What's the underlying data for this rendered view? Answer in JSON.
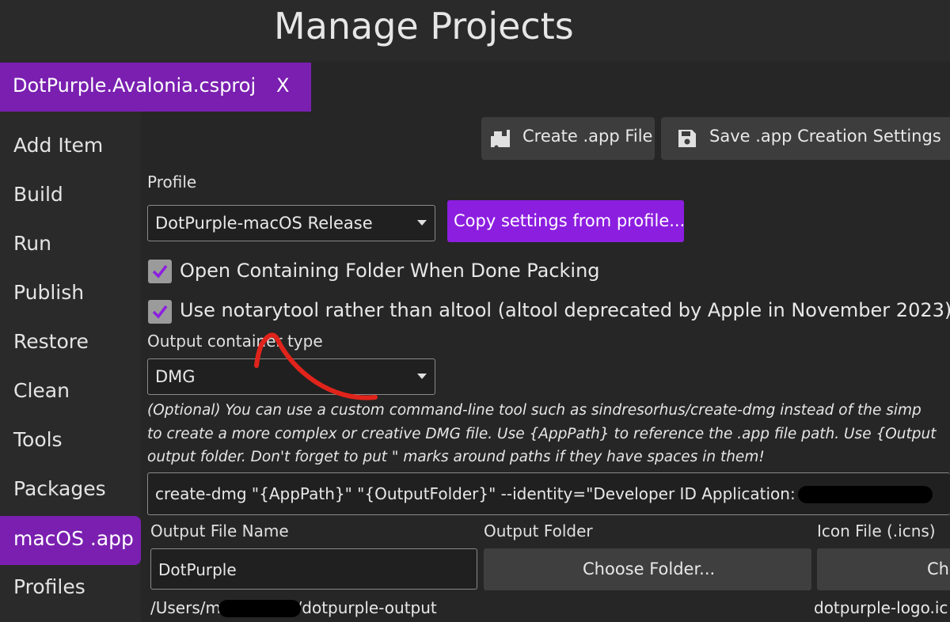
{
  "window": {
    "title": "Manage Projects"
  },
  "tab": {
    "label": "DotPurple.Avalonia.csproj",
    "close": "X"
  },
  "sidebar": {
    "items": [
      {
        "label": "Add Item"
      },
      {
        "label": "Build"
      },
      {
        "label": "Run"
      },
      {
        "label": "Publish"
      },
      {
        "label": "Restore"
      },
      {
        "label": "Clean"
      },
      {
        "label": "Tools"
      },
      {
        "label": "Packages"
      },
      {
        "label": "macOS .app",
        "active": true
      },
      {
        "label": "Profiles"
      }
    ]
  },
  "toolbar": {
    "create_label": "Create .app File",
    "save_label": "Save .app Creation Settings"
  },
  "profile": {
    "label": "Profile",
    "selected": "DotPurple-macOS Release",
    "copy_button": "Copy settings from profile..."
  },
  "options": {
    "open_folder": {
      "label": "Open Containing Folder When Done Packing",
      "checked": true
    },
    "notarytool": {
      "label": "Use notarytool rather than altool (altool deprecated by Apple in November 2023)",
      "checked": true
    }
  },
  "output_container": {
    "label": "Output container type",
    "selected": "DMG"
  },
  "help_text": {
    "line1": "(Optional) You can use a custom command-line tool such as sindresorhus/create-dmg instead of the simp",
    "line2": "to create a more complex or creative DMG file. Use {AppPath} to reference the .app file path. Use {Output",
    "line3": "output folder. Don't forget to put \" marks around paths if they have spaces in them!"
  },
  "command": {
    "value": "create-dmg \"{AppPath}\" \"{OutputFolder}\" --identity=\"Developer ID Application: M                         ("
  },
  "output_file": {
    "label": "Output File Name",
    "value": "DotPurple",
    "path": "/Users/m                /Desktop/dotpurple-output"
  },
  "output_folder": {
    "label": "Output Folder",
    "button": "Choose Folder..."
  },
  "icon_file": {
    "label": "Icon File (.icns)",
    "button": "Ch",
    "path": "dotpurple-logo.ic"
  },
  "colors": {
    "accent": "#7a1fb0",
    "button_purple": "#8c1ee0",
    "background": "#262626",
    "annotation": "#e0241b"
  }
}
